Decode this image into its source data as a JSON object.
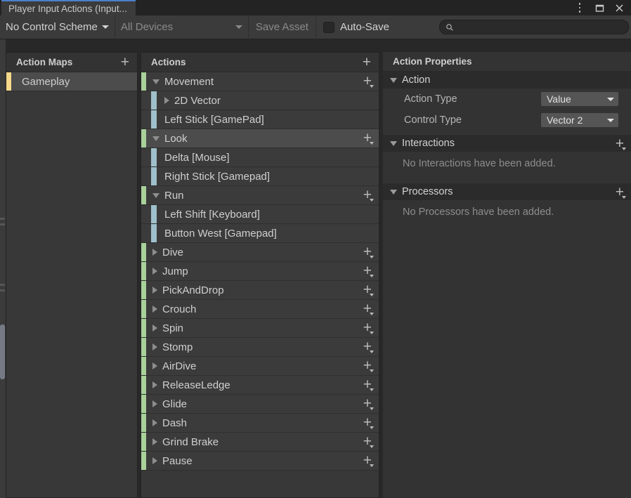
{
  "window": {
    "tab_title": "Player Input Actions (Input...",
    "controls": [
      {
        "name": "kebab-menu-button",
        "icon": "vertical-dots-icon"
      },
      {
        "name": "maximize-button",
        "icon": "maximize-icon"
      },
      {
        "name": "close-button",
        "icon": "close-icon"
      }
    ]
  },
  "toolbar": {
    "control_scheme": "No Control Scheme",
    "devices": "All Devices",
    "save_asset": "Save Asset",
    "auto_save": "Auto-Save",
    "auto_save_checked": false,
    "search_placeholder": "",
    "search_value": "",
    "search_icon": "search-icon"
  },
  "action_maps": {
    "title": "Action Maps",
    "add_label": "+",
    "items": [
      {
        "label": "Gameplay",
        "selected": true,
        "stripe": "#f7d98a"
      }
    ]
  },
  "actions": {
    "title": "Actions",
    "add_label": "+",
    "rows": [
      {
        "type": "action",
        "label": "Movement",
        "expanded": true,
        "selected": false
      },
      {
        "type": "binding",
        "label": "2D Vector",
        "expanded": false,
        "selected": false,
        "composite": true
      },
      {
        "type": "binding",
        "label": "Left Stick [GamePad]",
        "selected": false
      },
      {
        "type": "action",
        "label": "Look",
        "expanded": true,
        "selected": true
      },
      {
        "type": "binding",
        "label": "Delta [Mouse]",
        "selected": false
      },
      {
        "type": "binding",
        "label": "Right Stick [Gamepad]",
        "selected": false
      },
      {
        "type": "action",
        "label": "Run",
        "expanded": true,
        "selected": false
      },
      {
        "type": "binding",
        "label": "Left Shift [Keyboard]",
        "selected": false
      },
      {
        "type": "binding",
        "label": "Button West [Gamepad]",
        "selected": false
      },
      {
        "type": "action",
        "label": "Dive",
        "expanded": false,
        "selected": false
      },
      {
        "type": "action",
        "label": "Jump",
        "expanded": false,
        "selected": false
      },
      {
        "type": "action",
        "label": "PickAndDrop",
        "expanded": false,
        "selected": false
      },
      {
        "type": "action",
        "label": "Crouch",
        "expanded": false,
        "selected": false
      },
      {
        "type": "action",
        "label": "Spin",
        "expanded": false,
        "selected": false
      },
      {
        "type": "action",
        "label": "Stomp",
        "expanded": false,
        "selected": false
      },
      {
        "type": "action",
        "label": "AirDive",
        "expanded": false,
        "selected": false
      },
      {
        "type": "action",
        "label": "ReleaseLedge",
        "expanded": false,
        "selected": false
      },
      {
        "type": "action",
        "label": "Glide",
        "expanded": false,
        "selected": false
      },
      {
        "type": "action",
        "label": "Dash",
        "expanded": false,
        "selected": false
      },
      {
        "type": "action",
        "label": "Grind Brake",
        "expanded": false,
        "selected": false
      },
      {
        "type": "action",
        "label": "Pause",
        "expanded": false,
        "selected": false
      }
    ],
    "stripe_action": "#a9d19a",
    "stripe_binding": "#9fc0cb"
  },
  "properties": {
    "title": "Action Properties",
    "action_section": {
      "title": "Action",
      "expanded": true,
      "fields": [
        {
          "label": "Action Type",
          "value": "Value"
        },
        {
          "label": "Control Type",
          "value": "Vector 2"
        }
      ]
    },
    "interactions_section": {
      "title": "Interactions",
      "expanded": true,
      "empty_text": "No Interactions have been added.",
      "add_label": "+"
    },
    "processors_section": {
      "title": "Processors",
      "expanded": true,
      "empty_text": "No Processors have been added.",
      "add_label": "+"
    }
  },
  "colors": {
    "accent_tab": "#4b7fcb",
    "window_bg": "#282828",
    "panel_bg": "#383838",
    "row_bg": "#3b3b3b",
    "row_selected": "#4c4c4c"
  }
}
